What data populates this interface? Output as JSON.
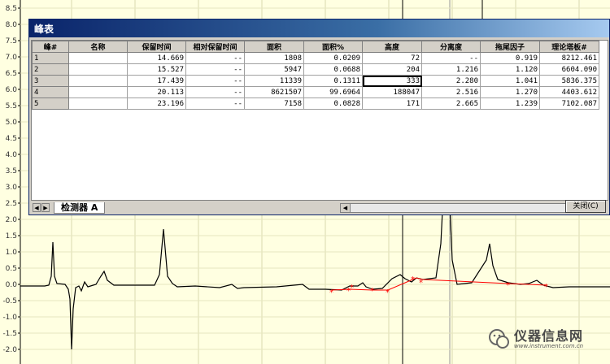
{
  "window": {
    "title": "峰表",
    "close_label": "关闭(C)",
    "tab_label": "检测器 A"
  },
  "table": {
    "headers": [
      "峰#",
      "名称",
      "保留时间",
      "相对保留时间",
      "面积",
      "面积%",
      "高度",
      "分离度",
      "拖尾因子",
      "理论塔板#"
    ],
    "rows": [
      [
        "1",
        "",
        "14.669",
        "--",
        "1808",
        "0.0209",
        "72",
        "--",
        "0.919",
        "8212.461"
      ],
      [
        "2",
        "",
        "15.527",
        "--",
        "5947",
        "0.0688",
        "204",
        "1.216",
        "1.120",
        "6604.090"
      ],
      [
        "3",
        "",
        "17.439",
        "--",
        "11339",
        "0.1311",
        "333",
        "2.280",
        "1.041",
        "5836.375"
      ],
      [
        "4",
        "",
        "20.113",
        "--",
        "8621507",
        "99.6964",
        "188047",
        "2.516",
        "1.270",
        "4403.612"
      ],
      [
        "5",
        "",
        "23.196",
        "--",
        "7158",
        "0.0828",
        "171",
        "2.665",
        "1.239",
        "7102.087"
      ]
    ],
    "selected_cell": {
      "row": 2,
      "col": 6
    }
  },
  "y_axis": {
    "ticks": [
      "8.5",
      "8.0",
      "7.5",
      "7.0",
      "6.5",
      "6.0",
      "5.5",
      "5.0",
      "4.5",
      "4.0",
      "3.5",
      "3.0",
      "2.5",
      "2.0",
      "1.5",
      "1.0",
      "0.5",
      "0.0",
      "-0.5",
      "-1.0",
      "-1.5",
      "-2.0"
    ]
  },
  "watermark": {
    "text": "仪器信息网",
    "url": "www.instrument.com.cn"
  },
  "colors": {
    "background": "#ffffe1",
    "trace": "#000000",
    "baseline": "#ff0000",
    "titlebar": "#0a246a"
  }
}
